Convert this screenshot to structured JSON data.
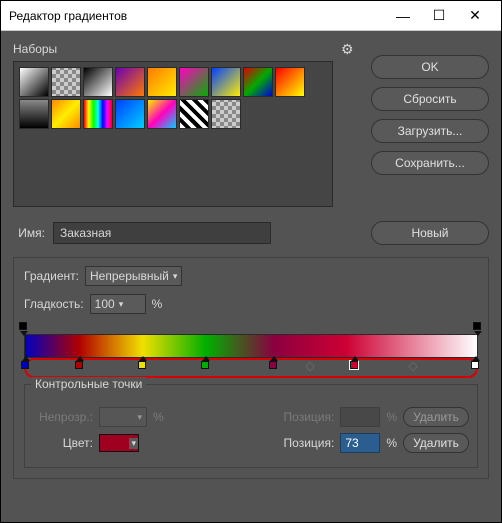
{
  "window": {
    "title": "Редактор градиентов"
  },
  "presets": {
    "label": "Наборы"
  },
  "buttons": {
    "ok": "OK",
    "reset": "Сбросить",
    "load": "Загрузить...",
    "save": "Сохранить...",
    "new": "Новый",
    "delete": "Удалить"
  },
  "name": {
    "label": "Имя:",
    "value": "Заказная"
  },
  "gradient_type": {
    "label": "Градиент:",
    "value": "Непрерывный"
  },
  "smoothness": {
    "label": "Гладкость:",
    "value": "100",
    "unit": "%"
  },
  "stops_section": {
    "title": "Контрольные точки",
    "opacity_label": "Непрозр.:",
    "opacity_value": "",
    "opacity_unit": "%",
    "position1_label": "Позиция:",
    "position1_value": "",
    "position1_unit": "%",
    "color_label": "Цвет:",
    "position2_label": "Позиция:",
    "position2_value": "73",
    "position2_unit": "%"
  },
  "gradient_stops": {
    "opacity_stops": [
      {
        "pos": 0,
        "opacity": 100
      },
      {
        "pos": 100,
        "opacity": 100
      }
    ],
    "color_stops": [
      {
        "pos": 0,
        "color": "#0000c0"
      },
      {
        "pos": 12,
        "color": "#b00000"
      },
      {
        "pos": 26,
        "color": "#f0e000"
      },
      {
        "pos": 40,
        "color": "#00b000"
      },
      {
        "pos": 55,
        "color": "#8b0040"
      },
      {
        "pos": 73,
        "color": "#cc0033",
        "selected": true
      },
      {
        "pos": 100,
        "color": "#ffffff"
      }
    ],
    "midpoints": [
      63,
      86
    ]
  },
  "preset_swatches": [
    "linear-gradient(135deg,#fff,#000)",
    "repeating-conic-gradient(#888 0 25%,#ccc 0 50%) 0/8px 8px",
    "linear-gradient(135deg,#000,#fff)",
    "linear-gradient(135deg,#6a00b0,#ff7a00)",
    "linear-gradient(135deg,#ff7a00,#ffee00)",
    "linear-gradient(135deg,#ff00c0,#00b000)",
    "linear-gradient(135deg,#0040ff,#ffee00)",
    "linear-gradient(135deg,#d00,#0a0,#00d)",
    "linear-gradient(135deg,#f00,#ff0)",
    "linear-gradient(to top,#000,#888)",
    "linear-gradient(135deg,#ff8a00,#ffee00,#ff8a00)",
    "linear-gradient(90deg,#f00,#ff0,#0f0,#0ff,#00f,#f0f,#f00)",
    "linear-gradient(135deg,#0040ff,#00d0ff)",
    "linear-gradient(135deg,#ffee00,#ff00c0,#00d0ff)",
    "repeating-linear-gradient(45deg,#fff 0 4px,#000 4px 8px)",
    "repeating-conic-gradient(#888 0 25%,#ccc 0 50%) 0/8px 8px"
  ]
}
